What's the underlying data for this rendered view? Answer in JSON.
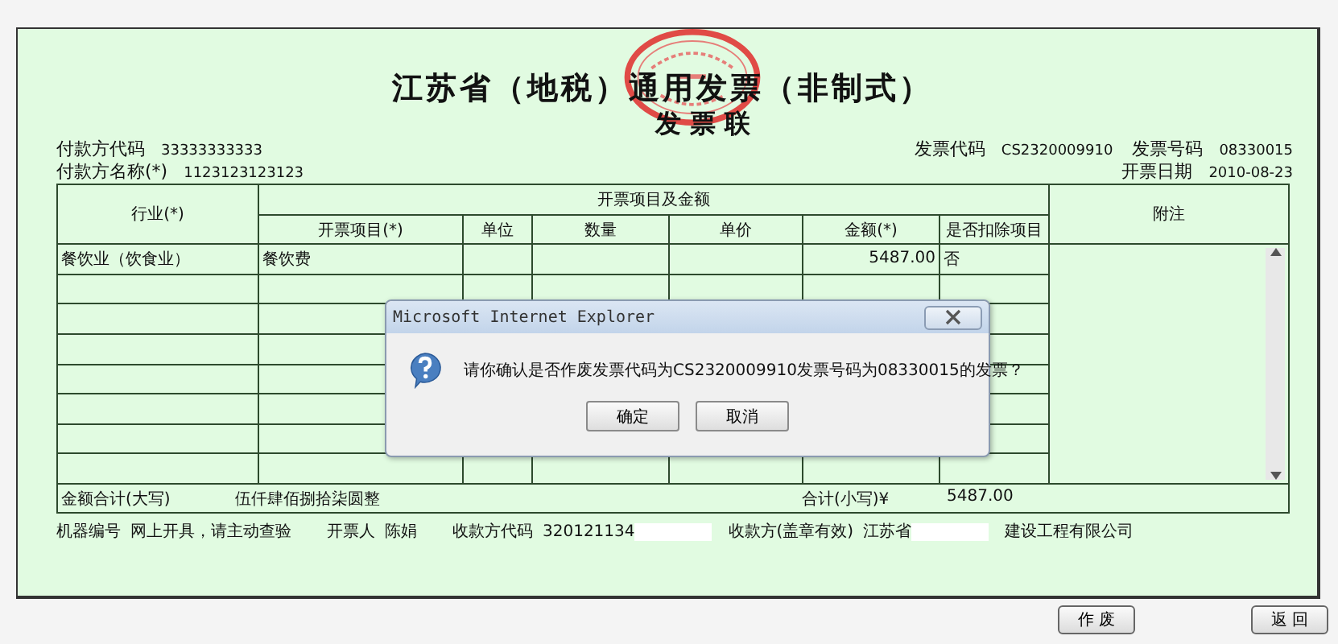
{
  "invoice": {
    "title": "江苏省（地税）通用发票（非制式）",
    "subtitle": "发 票 联",
    "payer_code": {
      "label": "付款方代码",
      "value": "33333333333"
    },
    "payer_name": {
      "label": "付款方名称(*)",
      "value": "1123123123123"
    },
    "invoice_code": {
      "label": "发票代码",
      "value": "CS2320009910"
    },
    "invoice_number": {
      "label": "发票号码",
      "value": "08330015"
    },
    "issue_date": {
      "label": "开票日期",
      "value": "2010-08-23"
    },
    "table": {
      "industry_header": "行业(*)",
      "group_header": "开票项目及金额",
      "columns": [
        "开票项目(*)",
        "单位",
        "数量",
        "单价",
        "金额(*)",
        "是否扣除项目"
      ],
      "notes_header": "附注",
      "rows": [
        {
          "industry": "餐饮业（饮食业）",
          "item": "餐饮费",
          "amount": "5487.00",
          "deduct": "否"
        }
      ],
      "total_words_label": "金额合计(大写)",
      "total_words": "伍仟肆佰捌拾柒圆整",
      "total_label": "合计(小写)¥",
      "total": "5487.00"
    },
    "footer": [
      {
        "label": "机器编号",
        "value": "网上开具，请主动查验"
      },
      {
        "label": "开票人",
        "value": "陈娟"
      },
      {
        "label": "收款方代码",
        "value": "320121134",
        "redacted": true
      },
      {
        "label": "收款方(盖章有效)",
        "value": "江苏省",
        "redacted": true,
        "value_tail": "建设工程有限公司"
      }
    ]
  },
  "buttons": [
    {
      "label": "作 废"
    },
    {
      "label": "返 回"
    }
  ],
  "dialog": {
    "title": "Microsoft Internet Explorer",
    "message": "请你确认是否作废发票代码为CS2320009910发票号码为08330015的发票？",
    "buttons": [
      "确定",
      "取消"
    ]
  }
}
